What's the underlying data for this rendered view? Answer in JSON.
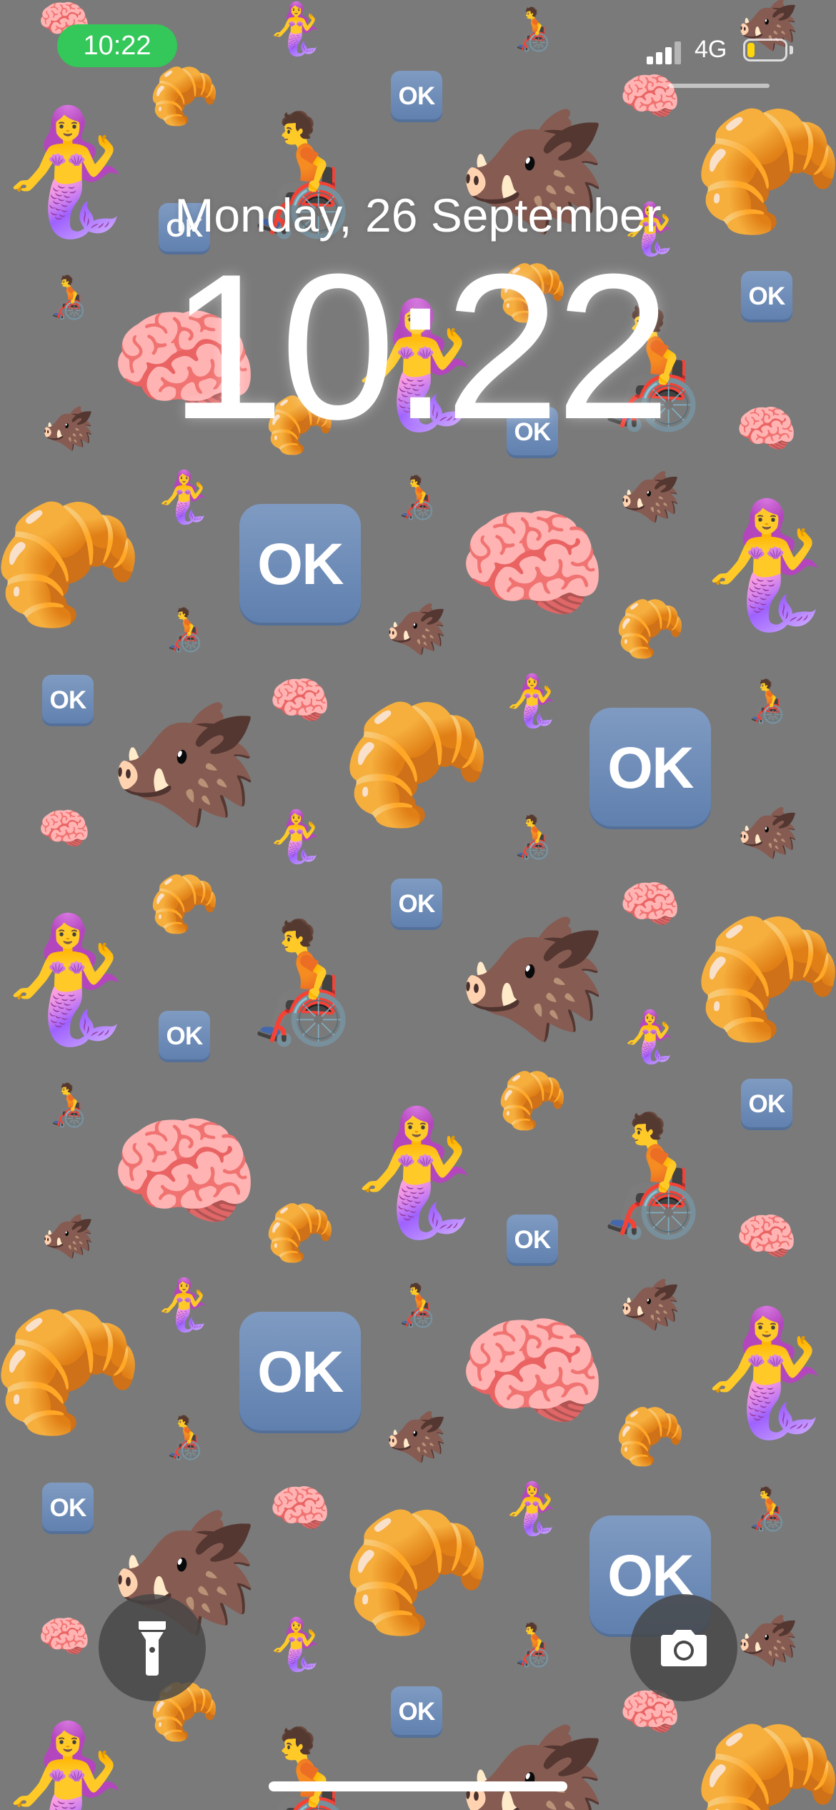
{
  "status_bar": {
    "time": "10:22",
    "time_pill_color": "#34c759",
    "network": "4G",
    "signal_bars": 3,
    "signal_bars_total": 4,
    "battery_level_fraction": 0.2,
    "battery_color": "#ffd60a"
  },
  "lock_screen": {
    "date": "Monday, 26 September",
    "time": "10:22"
  },
  "controls": {
    "flashlight_icon": "flashlight-icon",
    "camera_icon": "camera-icon"
  },
  "wallpaper": {
    "background_color": "#7a7a7a",
    "ok_label": "OK",
    "pattern_emojis": [
      "🧜‍♀️",
      "🧑‍🦽",
      "🐗",
      "🧠",
      "🥐",
      "🆗"
    ]
  }
}
